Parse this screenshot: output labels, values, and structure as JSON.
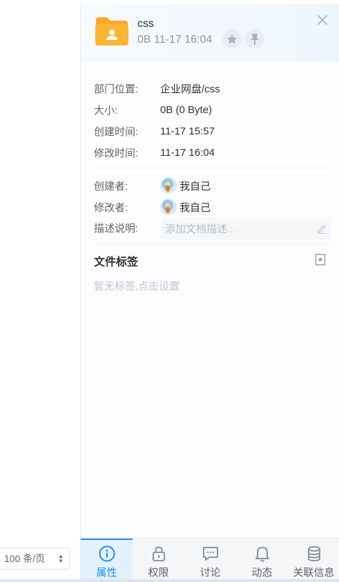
{
  "pagination": {
    "page_size_label": "100 条/页"
  },
  "file": {
    "name": "css",
    "meta": "0B 11-17 16:04"
  },
  "properties": [
    {
      "label": "部门位置:",
      "value": "企业网盘/css"
    },
    {
      "label": "大小:",
      "value": "0B (0 Byte)"
    },
    {
      "label": "创建时间:",
      "value": "11-17 15:57"
    },
    {
      "label": "修改时间:",
      "value": "11-17 16:04"
    }
  ],
  "people": {
    "creator_label": "创建者:",
    "creator_value": "我自己",
    "modifier_label": "修改者:",
    "modifier_value": "我自己"
  },
  "description": {
    "label": "描述说明:",
    "placeholder": "添加文档描述..."
  },
  "tags": {
    "title": "文件标签",
    "empty_text": "暂无标签,点击设置"
  },
  "tabs": [
    {
      "label": "属性",
      "icon": "info-icon",
      "active": true
    },
    {
      "label": "权限",
      "icon": "lock-icon",
      "active": false
    },
    {
      "label": "讨论",
      "icon": "chat-icon",
      "active": false
    },
    {
      "label": "动态",
      "icon": "bell-icon",
      "active": false
    },
    {
      "label": "关联信息",
      "icon": "database-icon",
      "active": false
    }
  ],
  "colors": {
    "accent": "#1a8fe3",
    "folder": "#fbb534"
  }
}
